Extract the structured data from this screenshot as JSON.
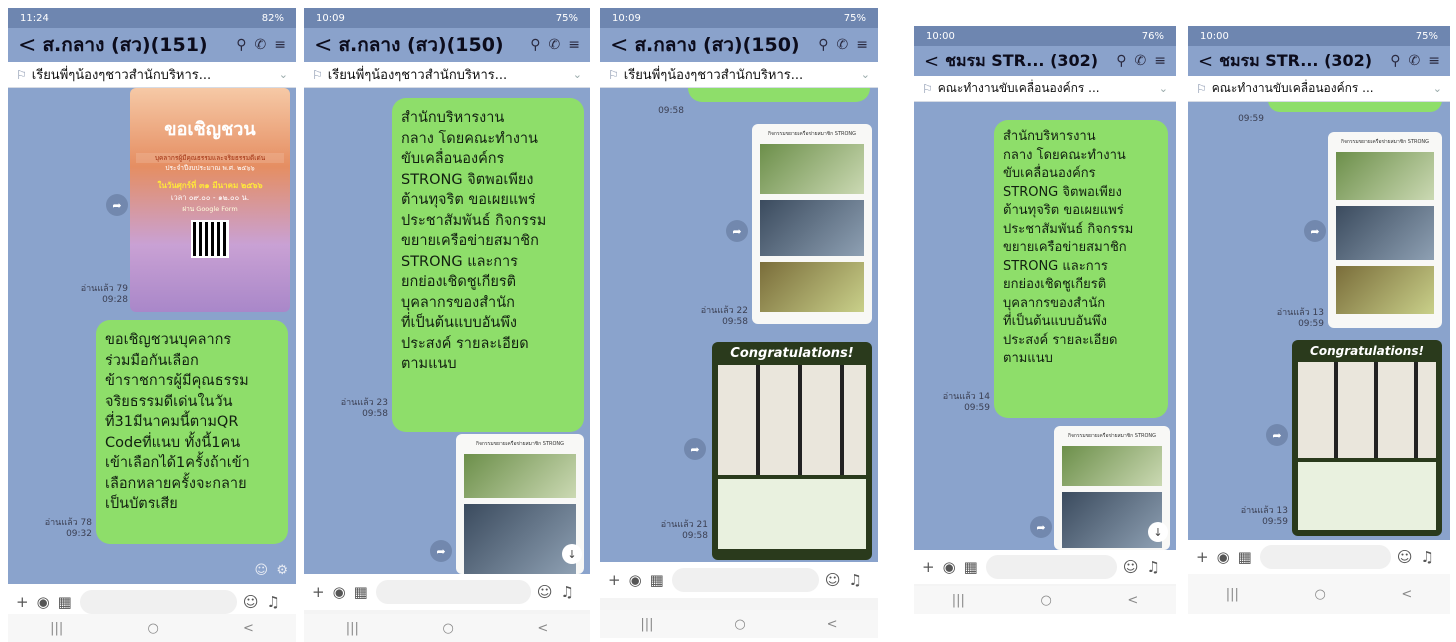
{
  "screens": [
    {
      "status_time": "11:24",
      "status_battery": "82%",
      "title": "ส.กลาง (สว)(151)",
      "pinned": "เรียนพี่ๆน้องๆชาวสำนักบริหาร...",
      "poster": {
        "heading": "ขอเชิญชวน",
        "line1": "บุคลากรผู้มีคุณธรรมและจริยธรรมดีเด่น",
        "line2": "ประจำปีงบประมาณ พ.ศ. ๒๕๖๖",
        "line3": "ในวันศุกร์ที่ ๓๑ มีนาคม ๒๕๖๖",
        "line4": "เวลา ๐๙.๐๐ - ๑๒.๐๐ น.",
        "line5": "ผ่าน Google Form"
      },
      "meta1_read": "อ่านแล้ว 79",
      "meta1_time": "09:28",
      "bubble": "ขอเชิญชวนบุคลากร\nร่วมมือกันเลือก\nข้าราชการผู้มีคุณธรรม\nจริยธรรมดีเด่นในวัน\nที่31มีนาคมนี้ตามQR\nCodeที่แนบ ทั้งนี้1คน\nเข้าเลือกได้1ครั้งถ้าเข้า\nเลือกหลายครั้งจะกลาย\nเป็นบัตรเสีย",
      "meta2_read": "อ่านแล้ว 78",
      "meta2_time": "09:32"
    },
    {
      "status_time": "10:09",
      "status_battery": "75%",
      "title": "ส.กลาง (สว)(150)",
      "pinned": "เรียนพี่ๆน้องๆชาวสำนักบริหาร...",
      "bubble": "สำนักบริหารงาน\nกลาง โดยคณะทำงาน\nขับเคลื่อนองค์กร\nSTRONG จิตพอเพียง\nต้านทุจริต ขอเผยแพร่\nประชาสัมพันธ์ กิจกรรม\nขยายเครือข่ายสมาชิก\nSTRONG และการ\nยกย่องเชิดชูเกียรติ\nบุคลากรของสำนัก\nที่เป็นต้นแบบอันพึง\nประสงค์ รายละเอียด\nตามแนบ",
      "meta_read": "อ่านแล้ว 23",
      "meta_time": "09:58"
    },
    {
      "status_time": "10:09",
      "status_battery": "75%",
      "title": "ส.กลาง (สว)(150)",
      "pinned": "เรียนพี่ๆน้องๆชาวสำนักบริหาร...",
      "top_time": "09:58",
      "meta1_read": "อ่านแล้ว 22",
      "meta1_time": "09:58",
      "congrats": "Congratulations!",
      "meta2_read": "อ่านแล้ว 21",
      "meta2_time": "09:58"
    },
    {
      "status_time": "10:00",
      "status_battery": "76%",
      "title": "ชมรม STR... (302)",
      "pinned": "คณะทำงานขับเคลื่อนองค์กร ...",
      "bubble": "สำนักบริหารงาน\nกลาง โดยคณะทำงาน\nขับเคลื่อนองค์กร\nSTRONG จิตพอเพียง\nต้านทุจริต ขอเผยแพร่\nประชาสัมพันธ์ กิจกรรม\nขยายเครือข่ายสมาชิก\nSTRONG และการ\nยกย่องเชิดชูเกียรติ\nบุคลากรของสำนัก\nที่เป็นต้นแบบอันพึง\nประสงค์ รายละเอียด\nตามแนบ",
      "meta_read": "อ่านแล้ว 14",
      "meta_time": "09:59"
    },
    {
      "status_time": "10:00",
      "status_battery": "75%",
      "title": "ชมรม STR... (302)",
      "pinned": "คณะทำงานขับเคลื่อนองค์กร ...",
      "top_time": "09:59",
      "meta1_read": "อ่านแล้ว 13",
      "meta1_time": "09:59",
      "congrats": "Congratulations!",
      "meta2_read": "อ่านแล้ว 13",
      "meta2_time": "09:59"
    }
  ],
  "doc_title": "กิจกรรมขยายเครือข่ายสมาชิก STRONG"
}
